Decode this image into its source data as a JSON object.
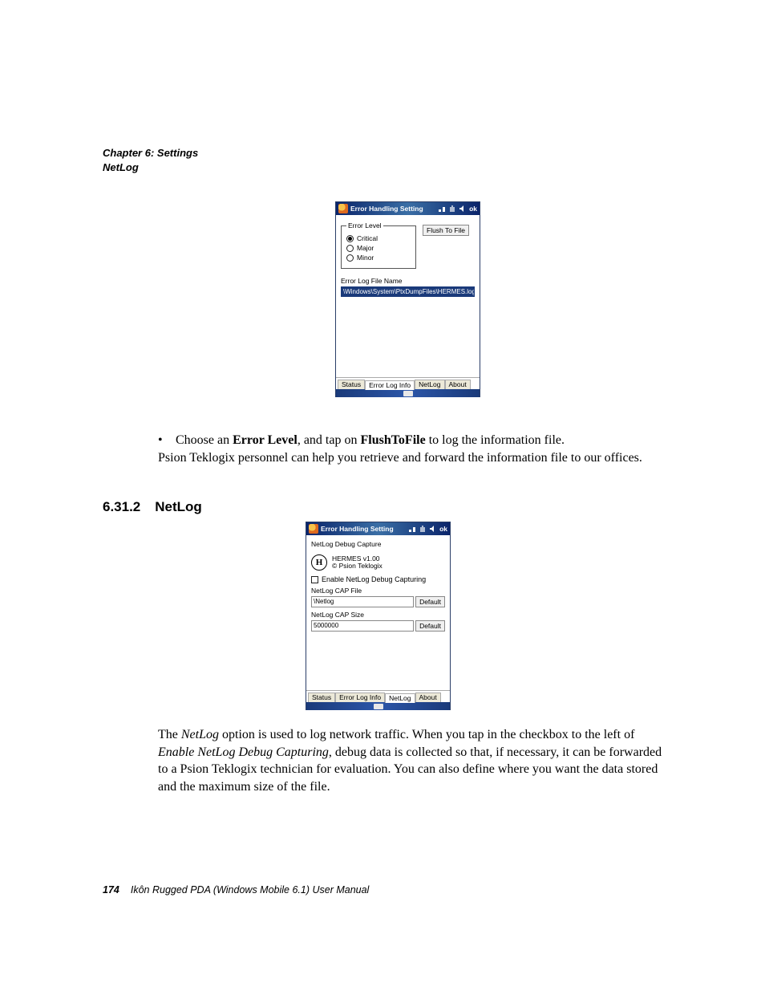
{
  "header": {
    "chapter": "Chapter 6: Settings",
    "section": "NetLog"
  },
  "wm1": {
    "title": "Error Handling Setting",
    "ok": "ok",
    "error_level_legend": "Error Level",
    "radios": {
      "critical": "Critical",
      "major": "Major",
      "minor": "Minor"
    },
    "flush_btn": "Flush To File",
    "logname_label": "Error Log File Name",
    "logname_value": "\\Windows\\System\\PtxDumpFiles\\HERMES.log",
    "tabs": {
      "status": "Status",
      "errorlog": "Error Log Info",
      "netlog": "NetLog",
      "about": "About"
    }
  },
  "bullet": {
    "prefix": "Choose an ",
    "bold1": "Error Level",
    "mid": ", and tap on ",
    "bold2": "FlushToFile",
    "suffix": " to log the information file."
  },
  "para1": "Psion Teklogix personnel can help you retrieve and forward the information file to our offices.",
  "heading": {
    "num": "6.31.2",
    "title": "NetLog"
  },
  "wm2": {
    "title": "Error Handling Setting",
    "ok": "ok",
    "caption": "NetLog Debug Capture",
    "hermes_line1": "HERMES v1.00",
    "hermes_line2": "© Psion Teklogix",
    "enable_label": "Enable NetLog Debug Capturing",
    "capfile_label": "NetLog CAP File",
    "capfile_value": "\\Netlog",
    "default_btn": "Default",
    "capsize_label": "NetLog CAP Size",
    "capsize_value": "5000000",
    "tabs": {
      "status": "Status",
      "errorlog": "Error Log Info",
      "netlog": "NetLog",
      "about": "About"
    }
  },
  "para2": {
    "s1_pre": "The ",
    "s1_it": "NetLog",
    "s1_post": " option is used to log network traffic. When you tap in the checkbox to the left of ",
    "s2_it": "Enable NetLog Debug Capturing",
    "s2_post": ", debug data is collected so that, if necessary, it can be forwarded to a Psion Teklogix technician for evaluation. You can also define where you want the data stored and the maximum size of the file."
  },
  "footer": {
    "page": "174",
    "book": "Ikôn Rugged PDA (Windows Mobile 6.1) User Manual"
  }
}
